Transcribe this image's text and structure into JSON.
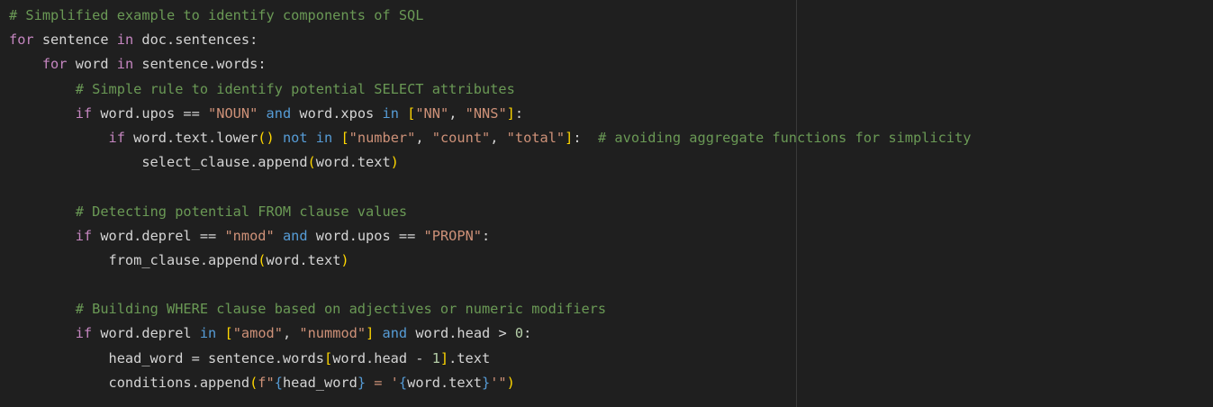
{
  "editor": {
    "language": "python",
    "lines": [
      [
        {
          "t": "# Simplified example to identify components of SQL",
          "c": "com"
        }
      ],
      [
        {
          "t": "for",
          "c": "ctl"
        },
        {
          "t": " sentence ",
          "c": "txt"
        },
        {
          "t": "in",
          "c": "ctl"
        },
        {
          "t": " doc.sentences:",
          "c": "txt"
        }
      ],
      [
        {
          "t": "    ",
          "c": "txt"
        },
        {
          "t": "for",
          "c": "ctl"
        },
        {
          "t": " word ",
          "c": "txt"
        },
        {
          "t": "in",
          "c": "ctl"
        },
        {
          "t": " sentence.words:",
          "c": "txt"
        }
      ],
      [
        {
          "t": "        ",
          "c": "txt"
        },
        {
          "t": "# Simple rule to identify potential SELECT attributes",
          "c": "com"
        }
      ],
      [
        {
          "t": "        ",
          "c": "txt"
        },
        {
          "t": "if",
          "c": "ctl"
        },
        {
          "t": " word.upos == ",
          "c": "txt"
        },
        {
          "t": "\"NOUN\"",
          "c": "str"
        },
        {
          "t": " ",
          "c": "txt"
        },
        {
          "t": "and",
          "c": "kw"
        },
        {
          "t": " word.xpos ",
          "c": "txt"
        },
        {
          "t": "in",
          "c": "kw"
        },
        {
          "t": " ",
          "c": "txt"
        },
        {
          "t": "[",
          "c": "b1"
        },
        {
          "t": "\"NN\"",
          "c": "str"
        },
        {
          "t": ", ",
          "c": "txt"
        },
        {
          "t": "\"NNS\"",
          "c": "str"
        },
        {
          "t": "]",
          "c": "b1"
        },
        {
          "t": ":",
          "c": "txt"
        }
      ],
      [
        {
          "t": "            ",
          "c": "txt"
        },
        {
          "t": "if",
          "c": "ctl"
        },
        {
          "t": " word.text.lower",
          "c": "txt"
        },
        {
          "t": "()",
          "c": "b1"
        },
        {
          "t": " ",
          "c": "txt"
        },
        {
          "t": "not",
          "c": "kw"
        },
        {
          "t": " ",
          "c": "txt"
        },
        {
          "t": "in",
          "c": "kw"
        },
        {
          "t": " ",
          "c": "txt"
        },
        {
          "t": "[",
          "c": "b1"
        },
        {
          "t": "\"number\"",
          "c": "str"
        },
        {
          "t": ", ",
          "c": "txt"
        },
        {
          "t": "\"count\"",
          "c": "str"
        },
        {
          "t": ", ",
          "c": "txt"
        },
        {
          "t": "\"total\"",
          "c": "str"
        },
        {
          "t": "]",
          "c": "b1"
        },
        {
          "t": ":  ",
          "c": "txt"
        },
        {
          "t": "# avoiding aggregate functions for simplicity",
          "c": "com"
        }
      ],
      [
        {
          "t": "                select_clause.append",
          "c": "txt"
        },
        {
          "t": "(",
          "c": "b1"
        },
        {
          "t": "word.text",
          "c": "txt"
        },
        {
          "t": ")",
          "c": "b1"
        }
      ],
      [],
      [
        {
          "t": "        ",
          "c": "txt"
        },
        {
          "t": "# Detecting potential FROM clause values",
          "c": "com"
        }
      ],
      [
        {
          "t": "        ",
          "c": "txt"
        },
        {
          "t": "if",
          "c": "ctl"
        },
        {
          "t": " word.deprel == ",
          "c": "txt"
        },
        {
          "t": "\"nmod\"",
          "c": "str"
        },
        {
          "t": " ",
          "c": "txt"
        },
        {
          "t": "and",
          "c": "kw"
        },
        {
          "t": " word.upos == ",
          "c": "txt"
        },
        {
          "t": "\"PROPN\"",
          "c": "str"
        },
        {
          "t": ":",
          "c": "txt"
        }
      ],
      [
        {
          "t": "            from_clause.append",
          "c": "txt"
        },
        {
          "t": "(",
          "c": "b1"
        },
        {
          "t": "word.text",
          "c": "txt"
        },
        {
          "t": ")",
          "c": "b1"
        }
      ],
      [],
      [
        {
          "t": "        ",
          "c": "txt"
        },
        {
          "t": "# Building WHERE clause based on adjectives or numeric modifiers",
          "c": "com"
        }
      ],
      [
        {
          "t": "        ",
          "c": "txt"
        },
        {
          "t": "if",
          "c": "ctl"
        },
        {
          "t": " word.deprel ",
          "c": "txt"
        },
        {
          "t": "in",
          "c": "kw"
        },
        {
          "t": " ",
          "c": "txt"
        },
        {
          "t": "[",
          "c": "b1"
        },
        {
          "t": "\"amod\"",
          "c": "str"
        },
        {
          "t": ", ",
          "c": "txt"
        },
        {
          "t": "\"nummod\"",
          "c": "str"
        },
        {
          "t": "]",
          "c": "b1"
        },
        {
          "t": " ",
          "c": "txt"
        },
        {
          "t": "and",
          "c": "kw"
        },
        {
          "t": " word.head > ",
          "c": "txt"
        },
        {
          "t": "0",
          "c": "num"
        },
        {
          "t": ":",
          "c": "txt"
        }
      ],
      [
        {
          "t": "            head_word = sentence.words",
          "c": "txt"
        },
        {
          "t": "[",
          "c": "b1"
        },
        {
          "t": "word.head - ",
          "c": "txt"
        },
        {
          "t": "1",
          "c": "num"
        },
        {
          "t": "]",
          "c": "b1"
        },
        {
          "t": ".text",
          "c": "txt"
        }
      ],
      [
        {
          "t": "            conditions.append",
          "c": "txt"
        },
        {
          "t": "(",
          "c": "b1"
        },
        {
          "t": "f\"",
          "c": "str"
        },
        {
          "t": "{",
          "c": "kw"
        },
        {
          "t": "head_word",
          "c": "txt"
        },
        {
          "t": "}",
          "c": "kw"
        },
        {
          "t": " = '",
          "c": "str"
        },
        {
          "t": "{",
          "c": "kw"
        },
        {
          "t": "word.text",
          "c": "txt"
        },
        {
          "t": "}",
          "c": "kw"
        },
        {
          "t": "'\"",
          "c": "str"
        },
        {
          "t": ")",
          "c": "b1"
        }
      ]
    ]
  }
}
